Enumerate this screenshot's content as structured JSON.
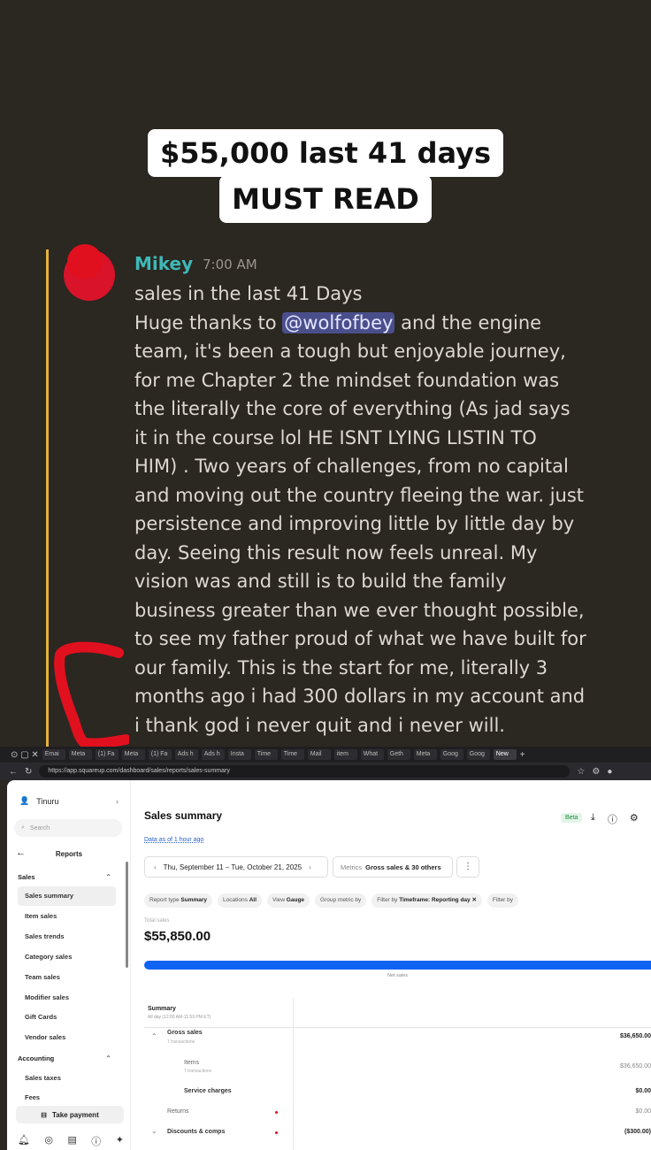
{
  "caption": {
    "line1": "$55,000 last 41 days",
    "line2": "MUST READ"
  },
  "message": {
    "username": "Mikey",
    "time": "7:00 AM",
    "lines": [
      "sales in the last 41 Days",
      "Huge thanks to ",
      "@wolfofbey",
      " and the engine",
      "team, it's been a tough but enjoyable journey,",
      "for me Chapter 2 the mindset foundation was",
      "the literally the core of everything (As jad says",
      "it in the course lol HE ISNT LYING LISTIN TO",
      "HIM) . Two years of challenges, from no capital",
      "and moving out the country fleeing the war. just",
      "persistence and improving little by little day by",
      "day. Seeing this result now feels unreal. My",
      "vision was and still is to build the family",
      "business greater than we ever thought possible,",
      "to see my father proud of what we have built for",
      "our family. This is the start for me, literally 3",
      "months ago i had 300 dollars in my account and",
      "i thank god i never quit and i never will."
    ]
  },
  "browser": {
    "tabs": [
      "Emai",
      "Meta",
      "(1) Fa",
      "Meta",
      "(1) Fa",
      "Ads h",
      "Ads h",
      "Insta",
      "Time",
      "Time",
      "Mail",
      "item",
      "What",
      "Geth",
      "Meta",
      "Goog",
      "Goog",
      "New"
    ],
    "url": "https://app.squareup.com/dashboard/sales/reports/sales-summary"
  },
  "sidebar": {
    "account": "Tinuru",
    "search_placeholder": "Search",
    "title": "Reports",
    "section_sales": "Sales",
    "items": [
      "Sales summary",
      "Item sales",
      "Sales trends",
      "Category sales",
      "Team sales",
      "Modifier sales",
      "Gift Cards",
      "Vendor sales"
    ],
    "section_accounting": "Accounting",
    "acct_items": [
      "Sales taxes",
      "Fees"
    ],
    "take_payment": "Take payment"
  },
  "main": {
    "title": "Sales summary",
    "beta": "Beta",
    "data_asof": "Data as of 1 hour ago",
    "date_range": "Thu, September 11 – Tue, October 21, 2025",
    "metrics_label": "Metrics",
    "metrics_value": "Gross sales & 30 others",
    "filters": [
      {
        "label": "Report type",
        "value": "Summary"
      },
      {
        "label": "Locations",
        "value": "All"
      },
      {
        "label": "View",
        "value": "Gauge"
      },
      {
        "label": "Group metric by",
        "value": ""
      },
      {
        "label": "Filter by",
        "value": "Timeframe: Reporting day ✕"
      },
      {
        "label": "Filter by",
        "value": ""
      }
    ],
    "total_label": "Total sales",
    "total_value": "$55,850.00",
    "gauge_label": "Net sales",
    "gauge_fraction": 1.0,
    "table": {
      "header": "Summary",
      "subheader": "All day (12:00 AM-11:59 PM ET)",
      "rows": [
        {
          "name": "Gross sales",
          "sub": "7 transactions",
          "value": "$36,650.00"
        },
        {
          "name": "Items",
          "sub": "7 transactions",
          "value": "$36,650.00"
        },
        {
          "name": "Service charges",
          "sub": "",
          "value": "$0.00"
        },
        {
          "name": "Returns",
          "sub": "",
          "value": "$0.00"
        },
        {
          "name": "Discounts & comps",
          "sub": "",
          "value": "($300.00)"
        }
      ]
    }
  },
  "colors": {
    "background": "#2b2721",
    "username": "#3fb8b8",
    "mention_bg": "#4a4f8c",
    "accent_bar": "#e6b23c",
    "red_scribble": "#e0101e",
    "gauge": "#1163f3"
  }
}
